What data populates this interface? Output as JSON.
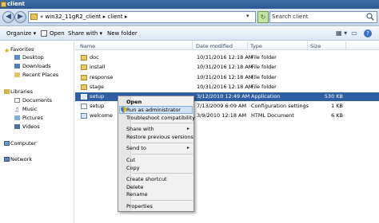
{
  "window": {
    "title": "client"
  },
  "address": {
    "path": "«  win32_11gR2_client  ▸  client  ▸",
    "search_placeholder": "Search client"
  },
  "toolbar": {
    "organize": "Organize ▾",
    "open": "Open",
    "share_with": "Share with ▾",
    "new_folder": "New folder"
  },
  "nav": {
    "favorites": "Favorites",
    "desktop": "Desktop",
    "downloads": "Downloads",
    "recent": "Recent Places",
    "libraries": "Libraries",
    "documents": "Documents",
    "music": "Music",
    "pictures": "Pictures",
    "videos": "Videos",
    "computer": "Computer",
    "network": "Network"
  },
  "columns": {
    "name": "Name",
    "date": "Date modified",
    "type": "Type",
    "size": "Size"
  },
  "files": [
    {
      "name": "doc",
      "date": "10/31/2016 12:18 AM",
      "type": "File folder",
      "size": ""
    },
    {
      "name": "install",
      "date": "10/31/2016 12:18 AM",
      "type": "File folder",
      "size": ""
    },
    {
      "name": "response",
      "date": "10/31/2016 12:18 AM",
      "type": "File folder",
      "size": ""
    },
    {
      "name": "stage",
      "date": "10/31/2016 12:18 AM",
      "type": "File folder",
      "size": ""
    },
    {
      "name": "setup",
      "date": "3/12/2010 12:49 AM",
      "type": "Application",
      "size": "530 KB"
    },
    {
      "name": "setup",
      "date": "7/13/2009 6:09 AM",
      "type": "Configuration settings",
      "size": "1 KB"
    },
    {
      "name": "welcome",
      "date": "3/9/2010 12:18 AM",
      "type": "HTML Document",
      "size": "6 KB"
    }
  ],
  "context_menu": {
    "open": "Open",
    "run_as_admin": "Run as administrator",
    "troubleshoot": "Troubleshoot compatibility",
    "share_with": "Share with",
    "restore": "Restore previous versions",
    "send_to": "Send to",
    "cut": "Cut",
    "copy": "Copy",
    "create_shortcut": "Create shortcut",
    "delete": "Delete",
    "rename": "Rename",
    "properties": "Properties"
  }
}
